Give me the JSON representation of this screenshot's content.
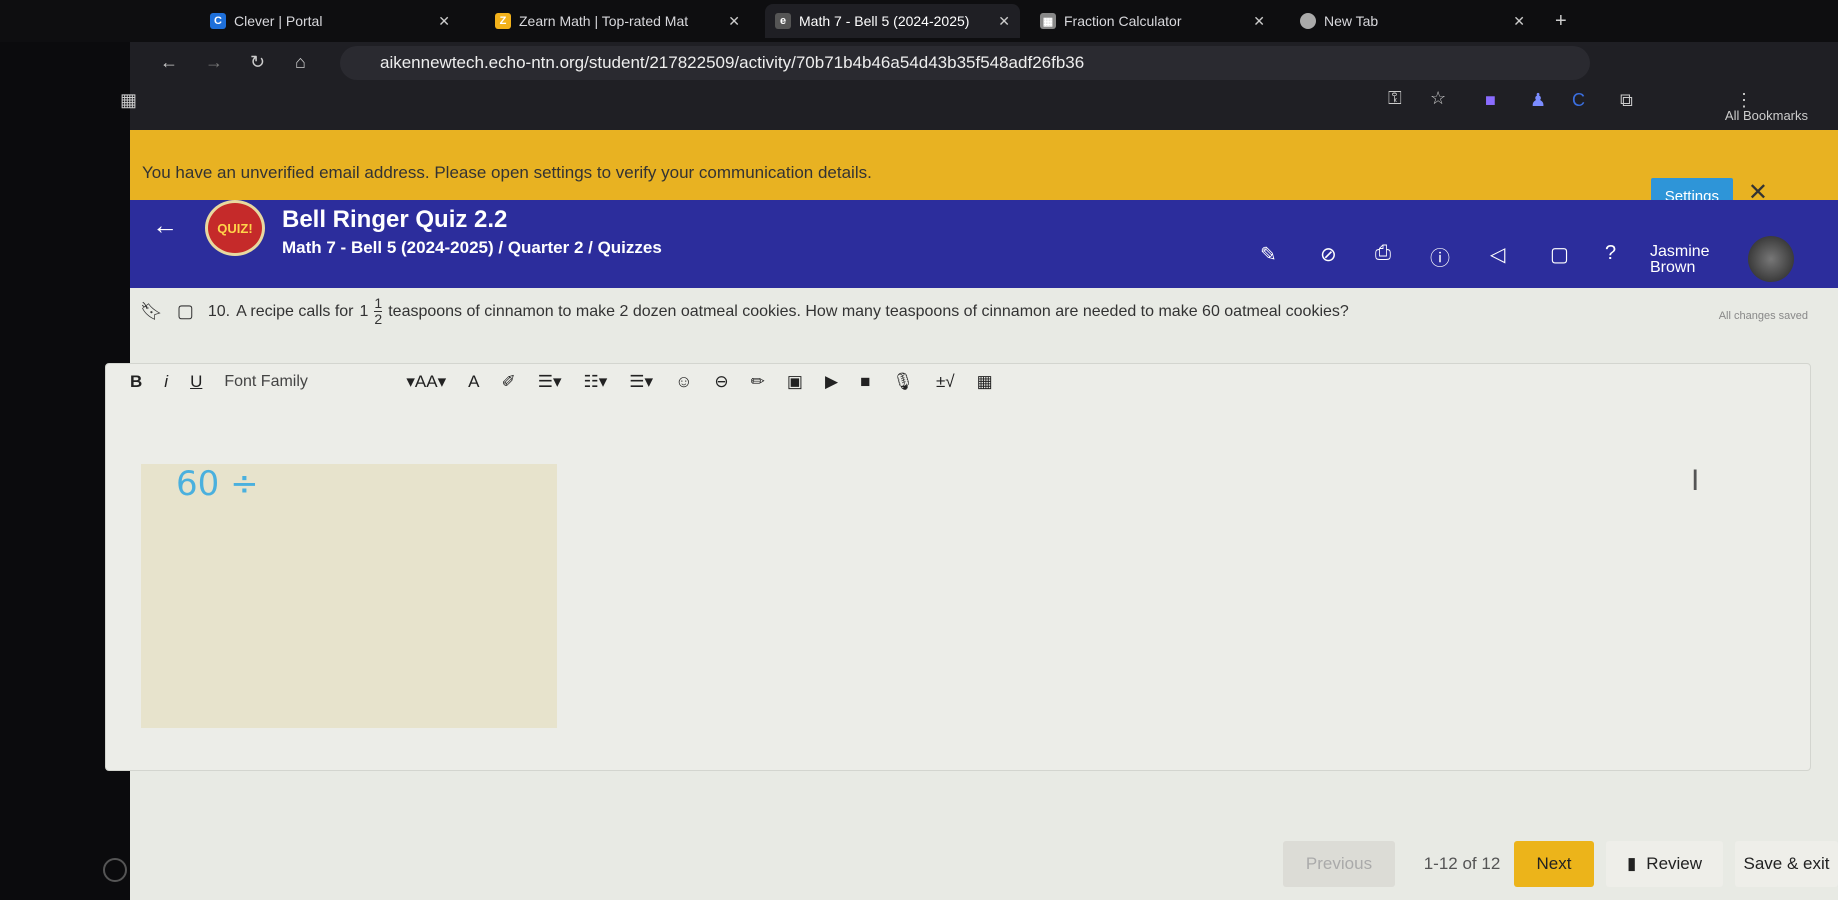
{
  "browser": {
    "tabs": [
      {
        "title": "Clever | Portal",
        "icon": "clever-icon",
        "color": "#1e6fd9"
      },
      {
        "title": "Zearn Math | Top-rated Mat",
        "icon": "zearn-icon",
        "color": "#f3b21b"
      },
      {
        "title": "Math 7 - Bell 5 (2024-2025)",
        "icon": "echo-icon",
        "color": "#555"
      },
      {
        "title": "Fraction Calculator",
        "icon": "calculator-icon",
        "color": "#888"
      },
      {
        "title": "New Tab",
        "icon": "chrome-icon",
        "color": "#aaa"
      }
    ],
    "active_tab": 2,
    "url": "aikennewtech.echo-ntn.org/student/217822509/activity/70b71b4b46a54d43b35f548adf26fb36",
    "bookmarks_label": "All Bookmarks"
  },
  "banner": {
    "message": "You have an unverified email address. Please open settings to verify your communication details.",
    "settings_label": "Settings",
    "color": "#e8b222"
  },
  "header": {
    "logo_text": "QUIZ!",
    "title": "Bell Ringer Quiz 2.2",
    "breadcrumb": "Math 7 - Bell 5 (2024-2025) / Quarter 2 / Quizzes",
    "user_first": "Jasmine",
    "user_last": "Brown",
    "color": "#2c2d9c"
  },
  "question": {
    "number": "10.",
    "text_before": "A recipe calls for",
    "whole": "1",
    "numerator": "1",
    "denominator": "2",
    "text_after": "teaspoons of cinnamon to make 2 dozen oatmeal cookies. How many teaspoons of cinnamon are needed to make 60 oatmeal cookies?",
    "save_status": "All changes saved"
  },
  "editor": {
    "font_family_label": "Font Family",
    "font_size_label": "AA",
    "drawing_text": "60 ÷"
  },
  "footer": {
    "previous": "Previous",
    "page_count": "1-12 of 12",
    "next": "Next",
    "review": "Review",
    "save_exit": "Save & exit",
    "next_color": "#ecb41a"
  }
}
